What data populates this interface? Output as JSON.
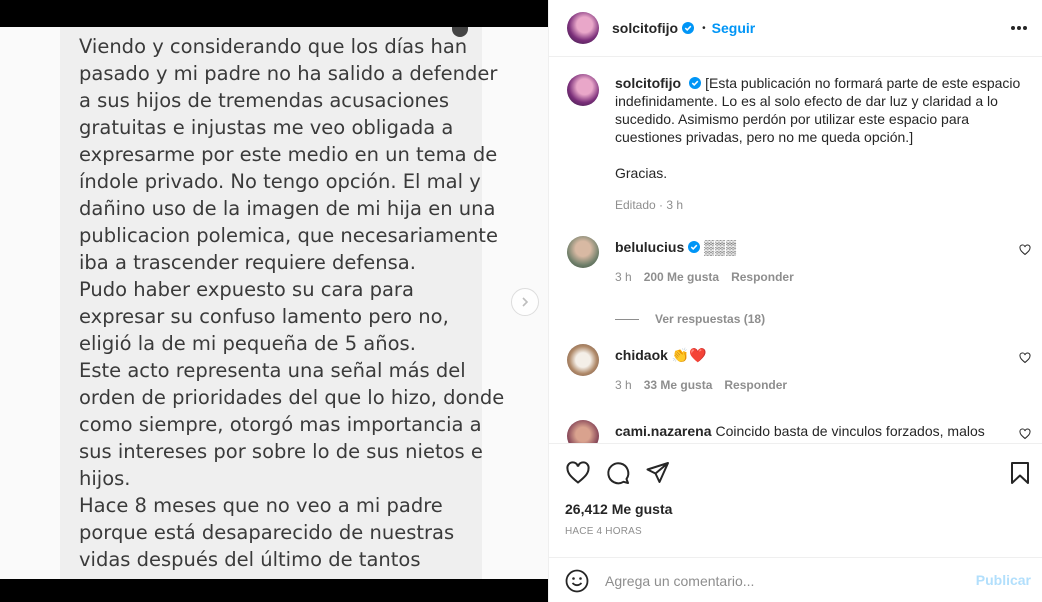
{
  "post_image": {
    "lines": [
      "Viendo y considerando que los días han",
      "pasado y mi padre no ha salido a defender",
      "a sus hijos de tremendas acusaciones",
      "gratuitas e injustas me veo obligada a",
      "expresarme por este medio en un tema de",
      "índole privado. No tengo opción. El mal y",
      "dañino uso de la imagen de mi hija en una",
      "publicacion polemica, que necesariamente",
      "iba a trascender requiere defensa.",
      "Pudo haber expuesto su cara para",
      "expresar su confuso lamento pero no,",
      "eligió la de mi pequeña de 5 años.",
      "Este acto representa una señal más del",
      "orden de prioridades del que lo hizo, donde",
      "como siempre, otorgó mas importancia a",
      "sus intereses por sobre lo de sus nietos e",
      "hijos.",
      "Hace 8 meses que no veo a mi padre",
      "porque está desaparecido de nuestras",
      "vidas después del último de tantos"
    ]
  },
  "header": {
    "username": "solcitofijo",
    "separator": "•",
    "follow_label": "Seguir"
  },
  "caption": {
    "username": "solcitofijo",
    "text": "[Esta publicación no formará parte de este espacio indefinidamente. Lo es al solo efecto de dar luz y claridad a lo sucedido. Asimismo perdón por utilizar este espacio para cuestiones privadas, pero no me queda opción.]",
    "thanks": "Gracias.",
    "meta": "Editado · 3 h"
  },
  "comments": [
    {
      "username": "belulucius",
      "text": "▒▒▒",
      "time": "3 h",
      "likes": "200 Me gusta",
      "reply": "Responder"
    },
    {
      "username": "chidaok",
      "text": "👏❤️",
      "time": "3 h",
      "likes": "33 Me gusta",
      "reply": "Responder"
    },
    {
      "username": "cami.nazarena",
      "text": "Coincido basta de vinculos forzados, malos"
    }
  ],
  "view_replies": "Ver respuestas (18)",
  "actions": {
    "likes_count": "26,412 Me gusta",
    "time_ago": "HACE 4 HORAS"
  },
  "composer": {
    "placeholder": "Agrega un comentario...",
    "publish_label": "Publicar"
  },
  "colors": {
    "accent": "#0095f6",
    "accent_disabled": "#b2dffc",
    "muted": "#8e8e8e",
    "text": "#262626"
  }
}
